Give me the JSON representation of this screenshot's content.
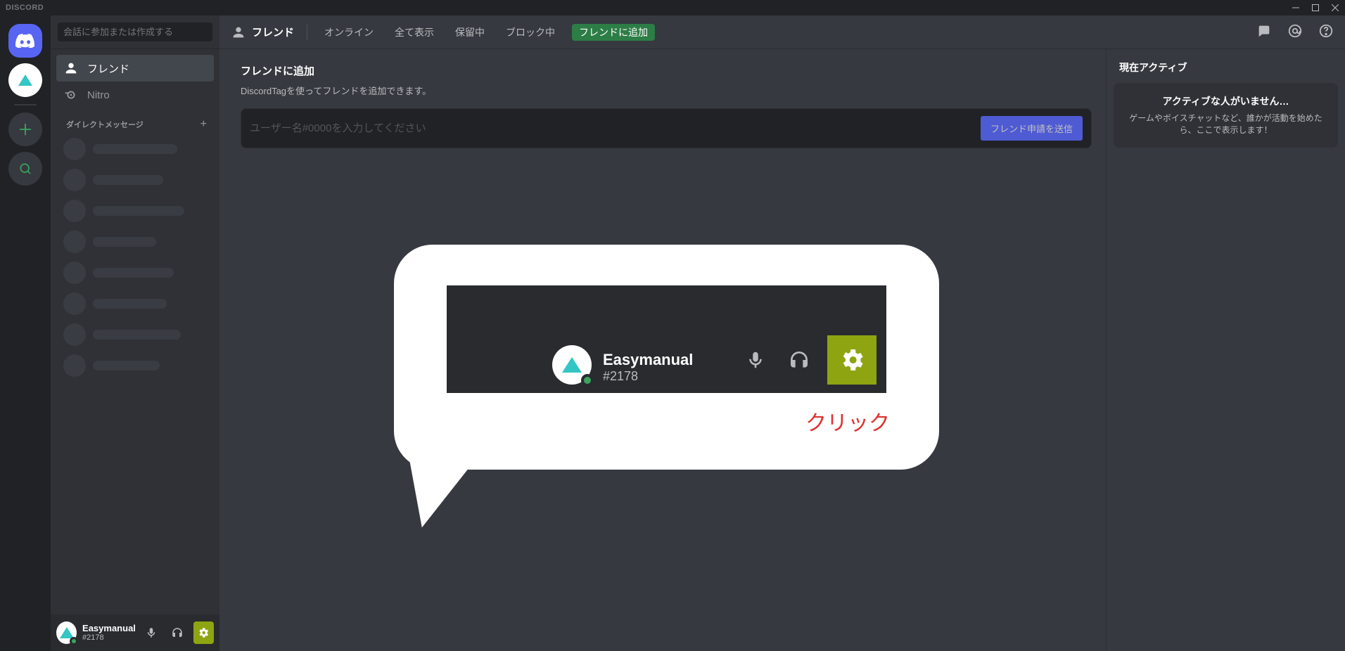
{
  "titlebar": {
    "brand": "DISCORD"
  },
  "search": {
    "placeholder": "会話に参加または作成する"
  },
  "sidebar": {
    "friends_label": "フレンド",
    "nitro_label": "Nitro",
    "dm_header": "ダイレクトメッセージ"
  },
  "topnav": {
    "title": "フレンド",
    "tabs": {
      "online": "オンライン",
      "all": "全て表示",
      "pending": "保留中",
      "blocked": "ブロック中"
    },
    "add_friend": "フレンドに追加"
  },
  "add_friend": {
    "heading": "フレンドに追加",
    "desc": "DiscordTagを使ってフレンドを追加できます。",
    "placeholder": "ユーザー名#0000を入力してください",
    "send_btn": "フレンド申請を送信"
  },
  "right": {
    "heading": "現在アクティブ",
    "title": "アクティブな人がいません…",
    "body": "ゲームやボイスチャットなど、誰かが活動を始めたら、ここで表示します！"
  },
  "user": {
    "name": "Easymanual",
    "tag": "#2178"
  },
  "callout": {
    "name": "Easymanual",
    "tag": "#2178",
    "label": "クリック"
  }
}
